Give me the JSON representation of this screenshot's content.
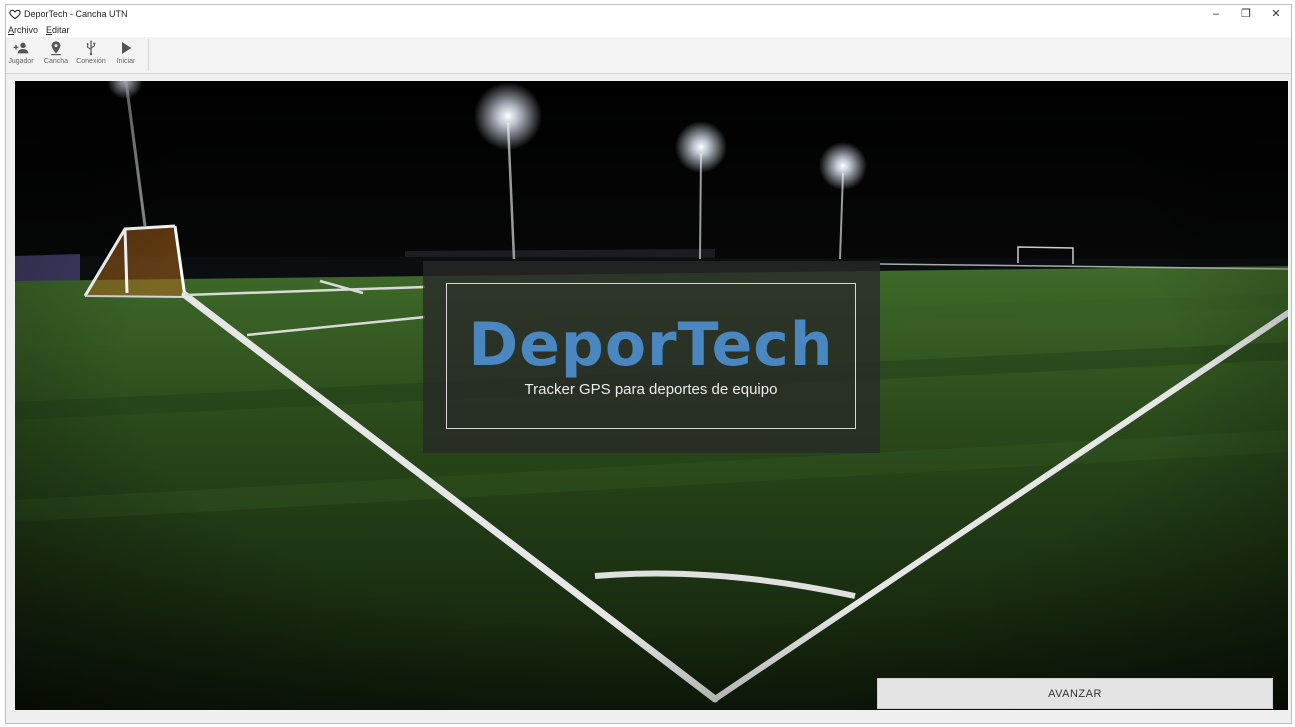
{
  "window": {
    "title": "DeporTech - Cancha UTN",
    "controls": {
      "minimize": "–",
      "restore": "❐",
      "close": "✕"
    }
  },
  "menu": {
    "items": [
      {
        "label": "Archivo"
      },
      {
        "label": "Editar"
      }
    ]
  },
  "toolbar": {
    "items": [
      {
        "label": "Jugador",
        "icon": "add-user-icon"
      },
      {
        "label": "Cancha",
        "icon": "location-pin-icon"
      },
      {
        "label": "Conexión",
        "icon": "usb-icon"
      },
      {
        "label": "Iniciar",
        "icon": "play-icon"
      }
    ]
  },
  "hero": {
    "title": "DeporTech",
    "subtitle": "Tracker GPS para deportes de equipo",
    "title_color": "#4a86c0"
  },
  "actions": {
    "advance_label": "AVANZAR"
  }
}
